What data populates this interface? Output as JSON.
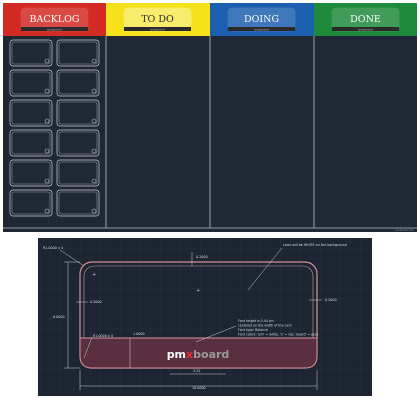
{
  "board": {
    "columns": [
      {
        "label": "BACKLOG",
        "color": "#d42a24",
        "textColor": "#ffffff"
      },
      {
        "label": "TO DO",
        "color": "#f5e21a",
        "textColor": "#2a2a2a"
      },
      {
        "label": "DOING",
        "color": "#1c5fae",
        "textColor": "#ffffff"
      },
      {
        "label": "DONE",
        "color": "#1f8a3c",
        "textColor": "#ffffff"
      }
    ],
    "header_brand": "pmxboard",
    "backlog_card_rows": 6,
    "backlog_card_cols": 2,
    "corner_note": "pmxboard.com"
  },
  "card_detail": {
    "dimensions": {
      "radius_top": "R1.0000 x 4",
      "radius_bottom": "R1.0000 x 4",
      "top_margin": "0.2000",
      "left_margin": "0.2000",
      "right_margin": "0.2000",
      "height": "6.0000",
      "width": "10.0000",
      "band_height": "1.0000",
      "font_width": "3.25"
    },
    "notes": {
      "background": "color will be WHITE on the background",
      "font_lines": [
        "Font height is 0.44 cm",
        "centered on the width of the card",
        "Font type: Balance",
        "Font colors: 'pm' = white, 'x' = red, 'board' = grey"
      ]
    },
    "logo": {
      "pm": "pm",
      "x": "x",
      "board": "board"
    },
    "colors": {
      "band": "#5a3040",
      "outline": "#d88f9a",
      "pm": "#ffffff",
      "x": "#e03030",
      "board": "#9a9a9a"
    }
  }
}
